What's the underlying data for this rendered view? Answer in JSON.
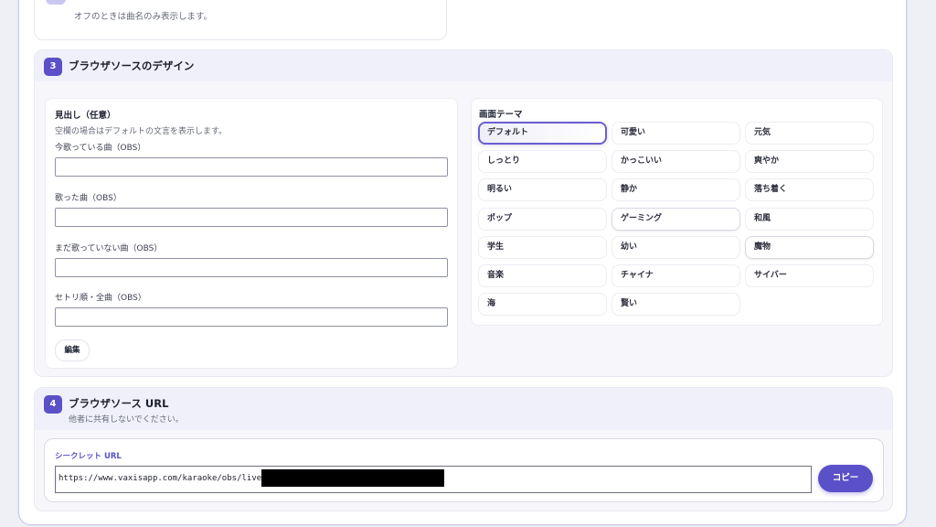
{
  "prev_card": {
    "note": "オフのときは曲名のみ表示します。"
  },
  "section3": {
    "number": "3",
    "title": "ブラウザソースのデザイン",
    "headings": {
      "title": "見出し（任意）",
      "subtitle": "空欄の場合はデフォルトの文言を表示します。",
      "fields": [
        {
          "label": "今歌っている曲（OBS）",
          "value": ""
        },
        {
          "label": "歌った曲（OBS）",
          "value": ""
        },
        {
          "label": "まだ歌っていない曲（OBS）",
          "value": ""
        },
        {
          "label": "セトリ順・全曲（OBS）",
          "value": ""
        }
      ],
      "edit_label": "編集"
    },
    "theme": {
      "title": "画面テーマ",
      "selected": "デフォルト",
      "options": [
        "デフォルト",
        "可愛い",
        "元気",
        "しっとり",
        "かっこいい",
        "爽やか",
        "明るい",
        "静か",
        "落ち着く",
        "ポップ",
        "ゲーミング",
        "和風",
        "学生",
        "幼い",
        "魔物",
        "音楽",
        "チャイナ",
        "サイバー",
        "海",
        "賢い"
      ]
    }
  },
  "section4": {
    "number": "4",
    "title": "ブラウザソース URL",
    "subtitle": "他者に共有しないでください。",
    "secret_label": "シークレット URL",
    "url_visible": "https://www.vaxisapp.com/karaoke/obs/live/",
    "copy_label": "コピー"
  },
  "colors": {
    "accent": "#5a50c8",
    "background": "#eef0f6",
    "header_bg": "#f0f0fa"
  }
}
